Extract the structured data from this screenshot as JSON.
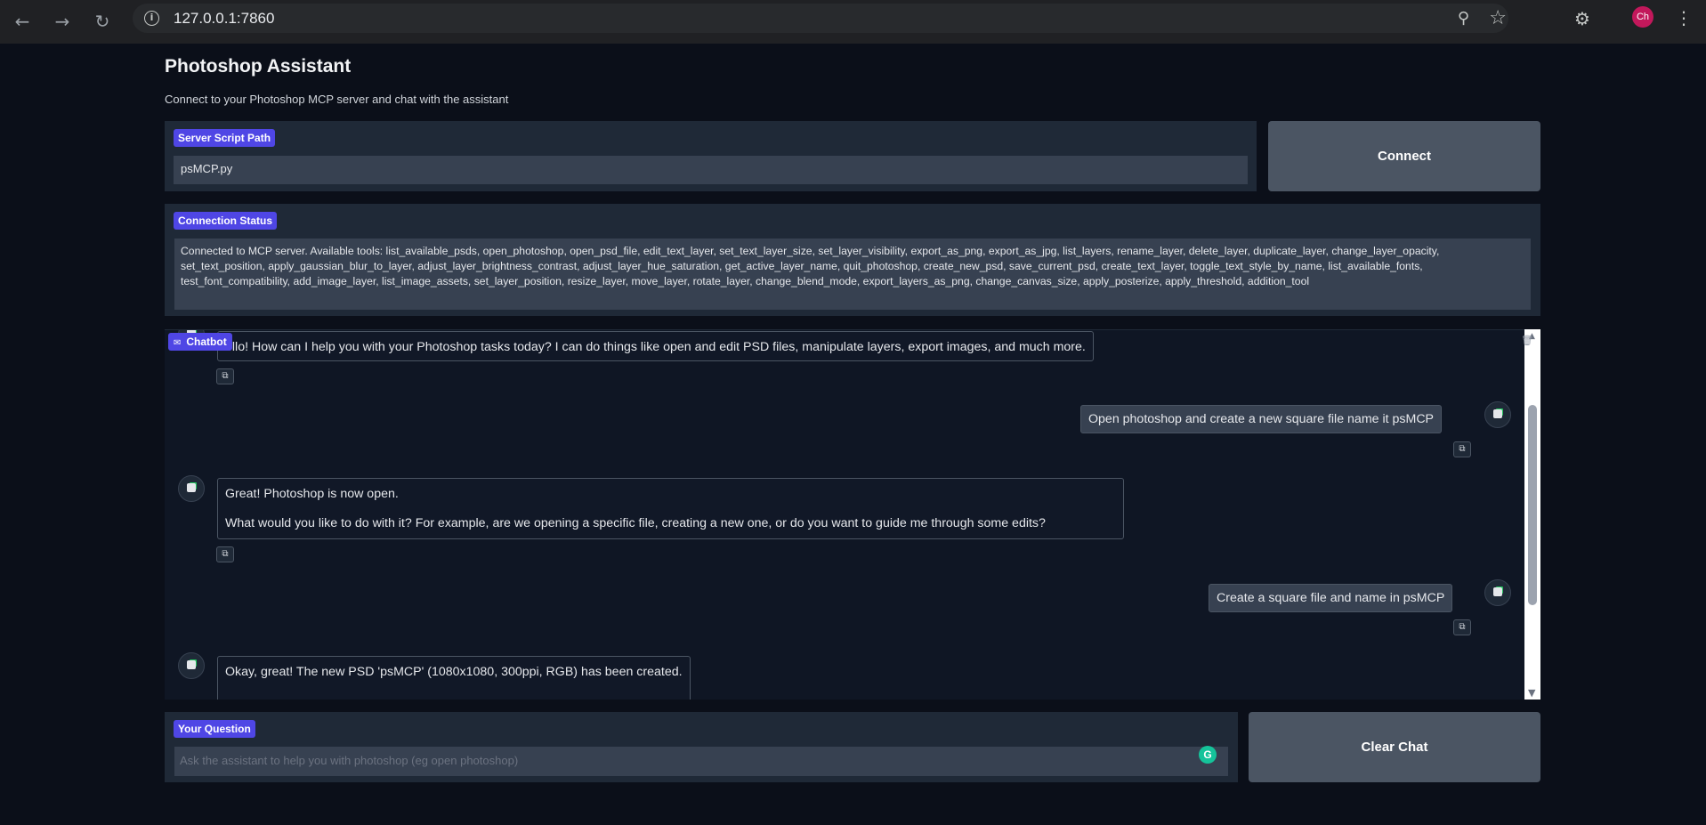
{
  "browser": {
    "url": "127.0.0.1:7860",
    "profile_initials": "Ch",
    "icons": [
      "back-icon",
      "forward-icon",
      "reload-icon",
      "info-icon",
      "zoom-icon",
      "star-icon",
      "extensions-icon",
      "menu-icon"
    ]
  },
  "page": {
    "title": "Photoshop Assistant",
    "subtitle": "Connect to your Photoshop MCP server and chat with the assistant"
  },
  "server": {
    "label": "Server Script Path",
    "value": "psMCP.py",
    "connect_label": "Connect"
  },
  "status": {
    "label": "Connection Status",
    "text": "Connected to MCP server. Available tools: list_available_psds, open_photoshop, open_psd_file, edit_text_layer, set_text_layer_size, set_layer_visibility, export_as_png, export_as_jpg, list_layers, rename_layer, delete_layer, duplicate_layer, change_layer_opacity, set_text_position, apply_gaussian_blur_to_layer, adjust_layer_brightness_contrast, adjust_layer_hue_saturation, get_active_layer_name, quit_photoshop, create_new_psd, save_current_psd, create_text_layer, toggle_text_style_by_name, list_available_fonts, test_font_compatibility, add_image_layer, list_image_assets, set_layer_position, resize_layer, move_layer, rotate_layer, change_blend_mode, export_layers_as_png, change_canvas_size, apply_posterize, apply_threshold, addition_tool"
  },
  "chat": {
    "label": "Chatbot",
    "messages": [
      {
        "role": "bot",
        "lines": [
          "ello! How can I help you with your Photoshop tasks today? I can do things like open and edit PSD files, manipulate layers, export images, and much more."
        ]
      },
      {
        "role": "user",
        "lines": [
          "Open photoshop and create a new square file name it psMCP"
        ]
      },
      {
        "role": "bot",
        "lines": [
          "Great! Photoshop is now open.",
          "What would you like to do with it? For example, are we opening a specific file, creating a new one, or do you want to guide me through some edits?"
        ]
      },
      {
        "role": "user",
        "lines": [
          "Create a square file and name in psMCP"
        ]
      },
      {
        "role": "bot",
        "lines": [
          "Okay, great! The new PSD 'psMCP' (1080x1080, 300ppi, RGB) has been created."
        ]
      }
    ]
  },
  "question": {
    "label": "Your Question",
    "placeholder": "Ask the assistant to help you with photoshop (eg open photoshop)",
    "clear_label": "Clear Chat"
  },
  "colors": {
    "background": "#0b0f19",
    "panel": "#1f2937",
    "field": "#374151",
    "accent": "#4f46e5",
    "button": "#4b5563"
  }
}
